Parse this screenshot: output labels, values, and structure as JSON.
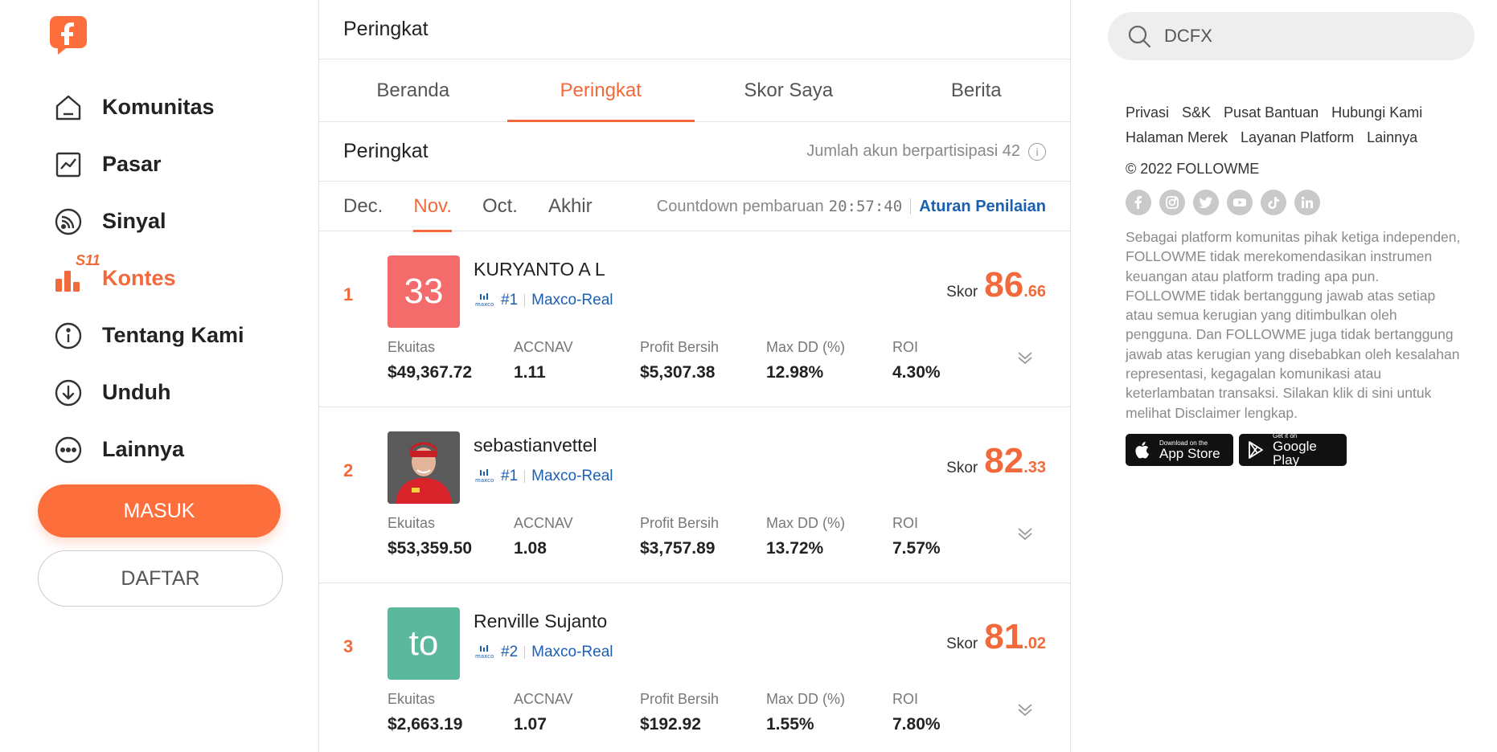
{
  "sidebar": {
    "nav": [
      {
        "label": "Komunitas",
        "icon": "home-icon"
      },
      {
        "label": "Pasar",
        "icon": "market-chart-icon"
      },
      {
        "label": "Sinyal",
        "icon": "signal-icon"
      },
      {
        "label": "Kontes",
        "icon": "contest-icon",
        "badge": "S11"
      },
      {
        "label": "Tentang Kami",
        "icon": "info-icon"
      },
      {
        "label": "Unduh",
        "icon": "download-icon"
      },
      {
        "label": "Lainnya",
        "icon": "more-icon"
      }
    ],
    "login_label": "MASUK",
    "register_label": "DAFTAR"
  },
  "main": {
    "header_title": "Peringkat",
    "tabs": [
      "Beranda",
      "Peringkat",
      "Skor Saya",
      "Berita"
    ],
    "ranking_title": "Peringkat",
    "participants": "Jumlah akun berpartisipasi 42",
    "months": [
      "Dec.",
      "Nov.",
      "Oct.",
      "Akhir"
    ],
    "countdown_label": "Countdown pembaruan",
    "countdown_time": "20:57:40",
    "rules_link": "Aturan Penilaian",
    "score_label": "Skor",
    "stat_labels": [
      "Ekuitas",
      "ACCNAV",
      "Profit Bersih",
      "Max DD (%)",
      "ROI"
    ],
    "entries": [
      {
        "rank": "1",
        "avatar_text": "33",
        "avatar_color": "#f46b6b",
        "name": "KURYANTO A L",
        "account": "#1",
        "server": "Maxco-Real",
        "score_int": "86",
        "score_dec": ".66",
        "stats": [
          "$49,367.72",
          "1.11",
          "$5,307.38",
          "12.98%",
          "4.30%"
        ]
      },
      {
        "rank": "2",
        "avatar_text": "",
        "avatar_color": "#8a2a2a",
        "name": "sebastianvettel",
        "account": "#1",
        "server": "Maxco-Real",
        "score_int": "82",
        "score_dec": ".33",
        "stats": [
          "$53,359.50",
          "1.08",
          "$3,757.89",
          "13.72%",
          "7.57%"
        ]
      },
      {
        "rank": "3",
        "avatar_text": "to",
        "avatar_color": "#5cb89c",
        "name": "Renville Sujanto",
        "account": "#2",
        "server": "Maxco-Real",
        "score_int": "81",
        "score_dec": ".02",
        "stats": [
          "$2,663.19",
          "1.07",
          "$192.92",
          "1.55%",
          "7.80%"
        ]
      }
    ]
  },
  "right": {
    "search_value": "DCFX",
    "links_row1": [
      "Privasi",
      "S&K",
      "Pusat Bantuan",
      "Hubungi Kami"
    ],
    "links_row2": [
      "Halaman Merek",
      "Layanan Platform",
      "Lainnya"
    ],
    "copyright": "© 2022 FOLLOWME",
    "socials": [
      "facebook-icon",
      "instagram-icon",
      "twitter-icon",
      "youtube-icon",
      "tiktok-icon",
      "linkedin-icon"
    ],
    "disclaimer": "Sebagai platform komunitas pihak ketiga independen, FOLLOWME tidak merekomendasikan instrumen keuangan atau platform trading apa pun. FOLLOWME tidak bertanggung jawab atas setiap atau semua kerugian yang ditimbulkan oleh pengguna. Dan FOLLOWME juga tidak bertanggung jawab atas kerugian yang disebabkan oleh kesalahan representasi, kegagalan komunikasi atau keterlambatan transaksi. Silakan klik di sini untuk melihat Disclaimer lengkap.",
    "appstore_small": "Download on the",
    "appstore_big": "App Store",
    "googleplay_small": "Get it on",
    "googleplay_big": "Google Play"
  },
  "colors": {
    "accent": "#f26a3b",
    "link": "#1a5fb4"
  }
}
